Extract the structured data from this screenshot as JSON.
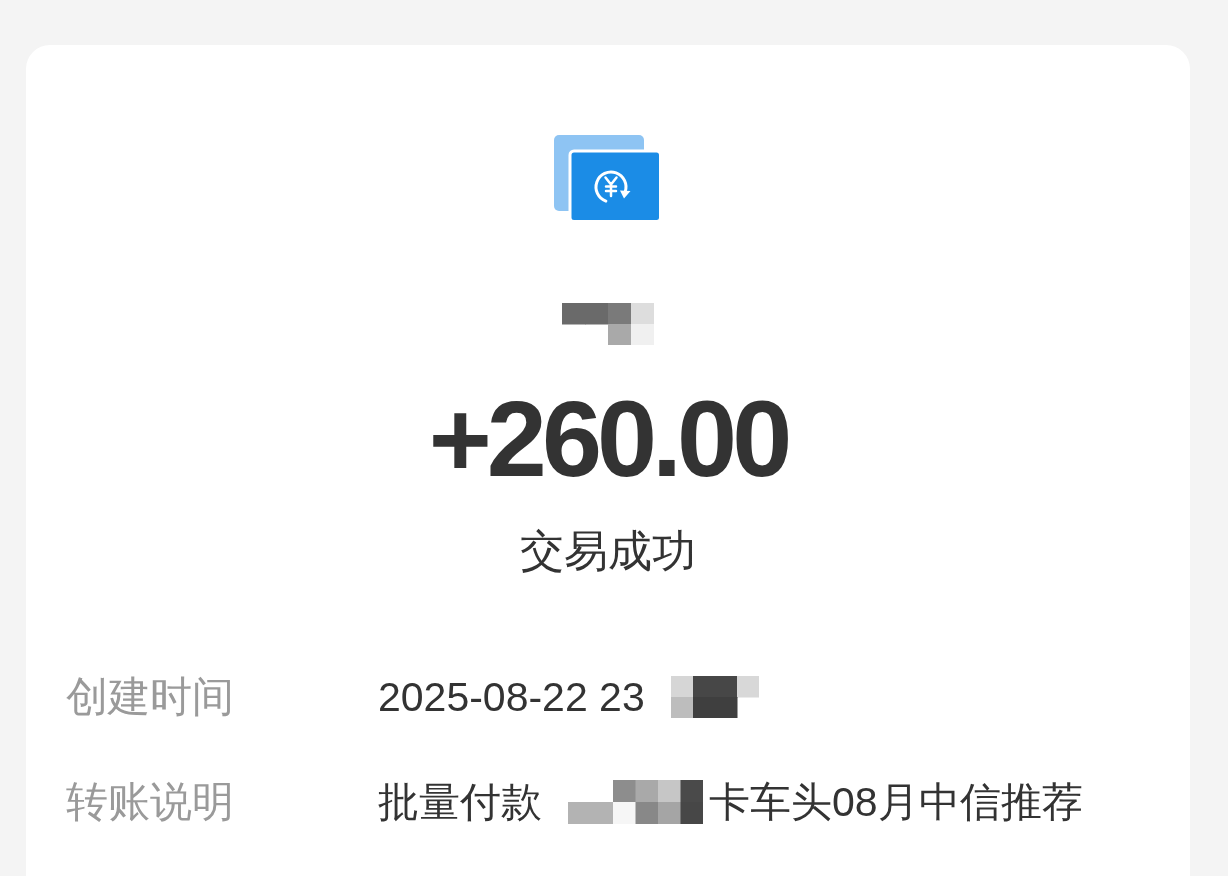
{
  "header": {
    "counterparty": [
      {
        "kind": "redacted"
      }
    ],
    "amount": "+260.00",
    "status": "交易成功"
  },
  "details": [
    {
      "label": "创建时间",
      "value": [
        {
          "kind": "text",
          "text": "2025-08-22 23"
        },
        {
          "kind": "redacted"
        }
      ]
    },
    {
      "label": "转账说明",
      "value": [
        {
          "kind": "text",
          "text": "批量付款"
        },
        {
          "kind": "redacted"
        },
        {
          "kind": "text",
          "text": "卡车头08月中信推荐"
        }
      ]
    }
  ]
}
